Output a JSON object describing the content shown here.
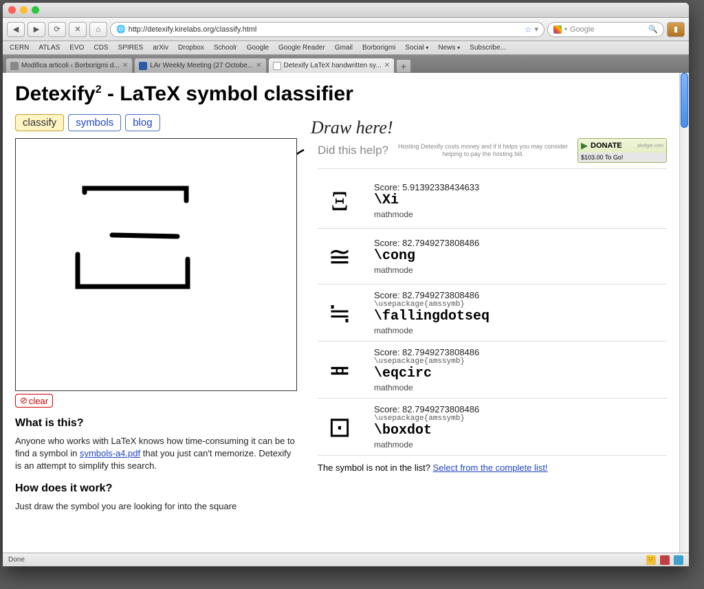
{
  "browser": {
    "url": "http://detexify.kirelabs.org/classify.html",
    "search_placeholder": "Google",
    "status": "Done",
    "bookmarks": [
      "CERN",
      "ATLAS",
      "EVO",
      "CDS",
      "SPIRES",
      "arXiv",
      "Dropbox",
      "Schoolr",
      "Google",
      "Google Reader",
      "Gmail",
      "Borborigmi",
      "Social",
      "News",
      "Subscribe..."
    ],
    "tabs": [
      {
        "label": "Modifica articoli ‹ Borborigmi d..."
      },
      {
        "label": "LAr Weekly Meeting (27 Octobe..."
      },
      {
        "label": "Detexify LaTeX handwritten sy..."
      }
    ]
  },
  "page": {
    "title_a": "Detexify",
    "title_sup": "2",
    "title_b": " - LaTeX symbol classifier",
    "nav": {
      "classify": "classify",
      "symbols": "symbols",
      "blog": "blog"
    },
    "draw_here": "Draw here!",
    "clear": "clear",
    "what_h": "What is this?",
    "what_p1": "Anyone who works with LaTeX knows how time-consuming it can be to find a symbol in ",
    "what_link": "symbols-a4.pdf",
    "what_p2": " that you just can't memorize. Detexify is an attempt to simplify this search.",
    "how_h": "How does it work?",
    "how_p": "Just draw the symbol you are looking for into the square",
    "help": {
      "q": "Did this help?",
      "txt": "Hosting Detexify costs money and if it helps you may consider helping to pay the hosting bill.",
      "donate": "DONATE",
      "pledgie": "pledgie.com",
      "togo": "$103.00 To Go!"
    },
    "results": [
      {
        "score": "Score: 5.91392338434633",
        "pkg": "",
        "cmd": "\\Xi",
        "mode": "mathmode",
        "glyph": "Ξ"
      },
      {
        "score": "Score: 82.7949273808486",
        "pkg": "",
        "cmd": "\\cong",
        "mode": "mathmode",
        "glyph": "≅"
      },
      {
        "score": "Score: 82.7949273808486",
        "pkg": "\\usepackage{amssymb}",
        "cmd": "\\fallingdotseq",
        "mode": "mathmode",
        "glyph": "≒"
      },
      {
        "score": "Score: 82.7949273808486",
        "pkg": "\\usepackage{amssymb}",
        "cmd": "\\eqcirc",
        "mode": "mathmode",
        "glyph": "≖"
      },
      {
        "score": "Score: 82.7949273808486",
        "pkg": "\\usepackage{amssymb}",
        "cmd": "\\boxdot",
        "mode": "mathmode",
        "glyph": "⊡"
      }
    ],
    "notfound_a": "The symbol is not in the list? ",
    "notfound_b": "Select from the complete list!"
  }
}
